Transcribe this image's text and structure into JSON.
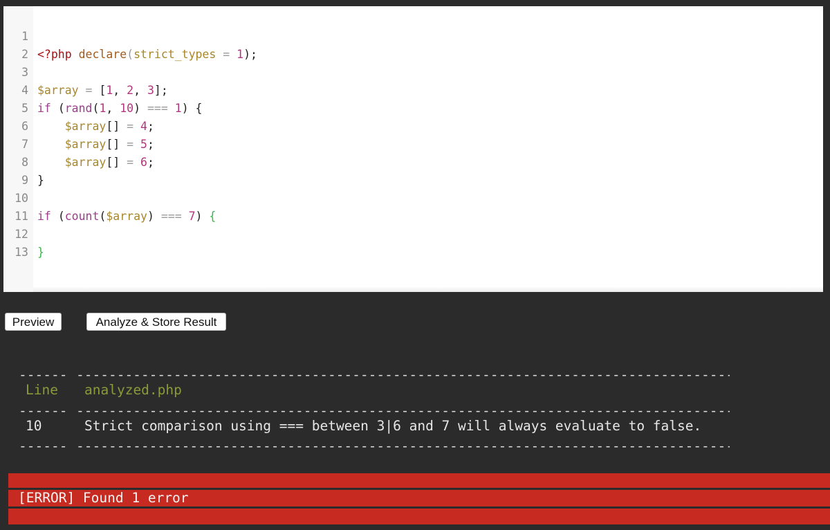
{
  "editor": {
    "line_numbers": [
      "1",
      "2",
      "3",
      "4",
      "5",
      "6",
      "7",
      "8",
      "9",
      "10",
      "11",
      "12",
      "13"
    ]
  },
  "buttons": {
    "preview": "Preview",
    "analyze": "Analyze & Store Result"
  },
  "report": {
    "header_line": "Line",
    "header_file": "analyzed.php",
    "row_line": "10",
    "row_message": "Strict comparison using === between 3|6 and 7 will always evaluate to false.",
    "error_summary": "[ERROR] Found 1 error"
  },
  "colors": {
    "background": "#2b2b2b",
    "error": "#c62a20",
    "header_text": "#8a9a3a"
  }
}
